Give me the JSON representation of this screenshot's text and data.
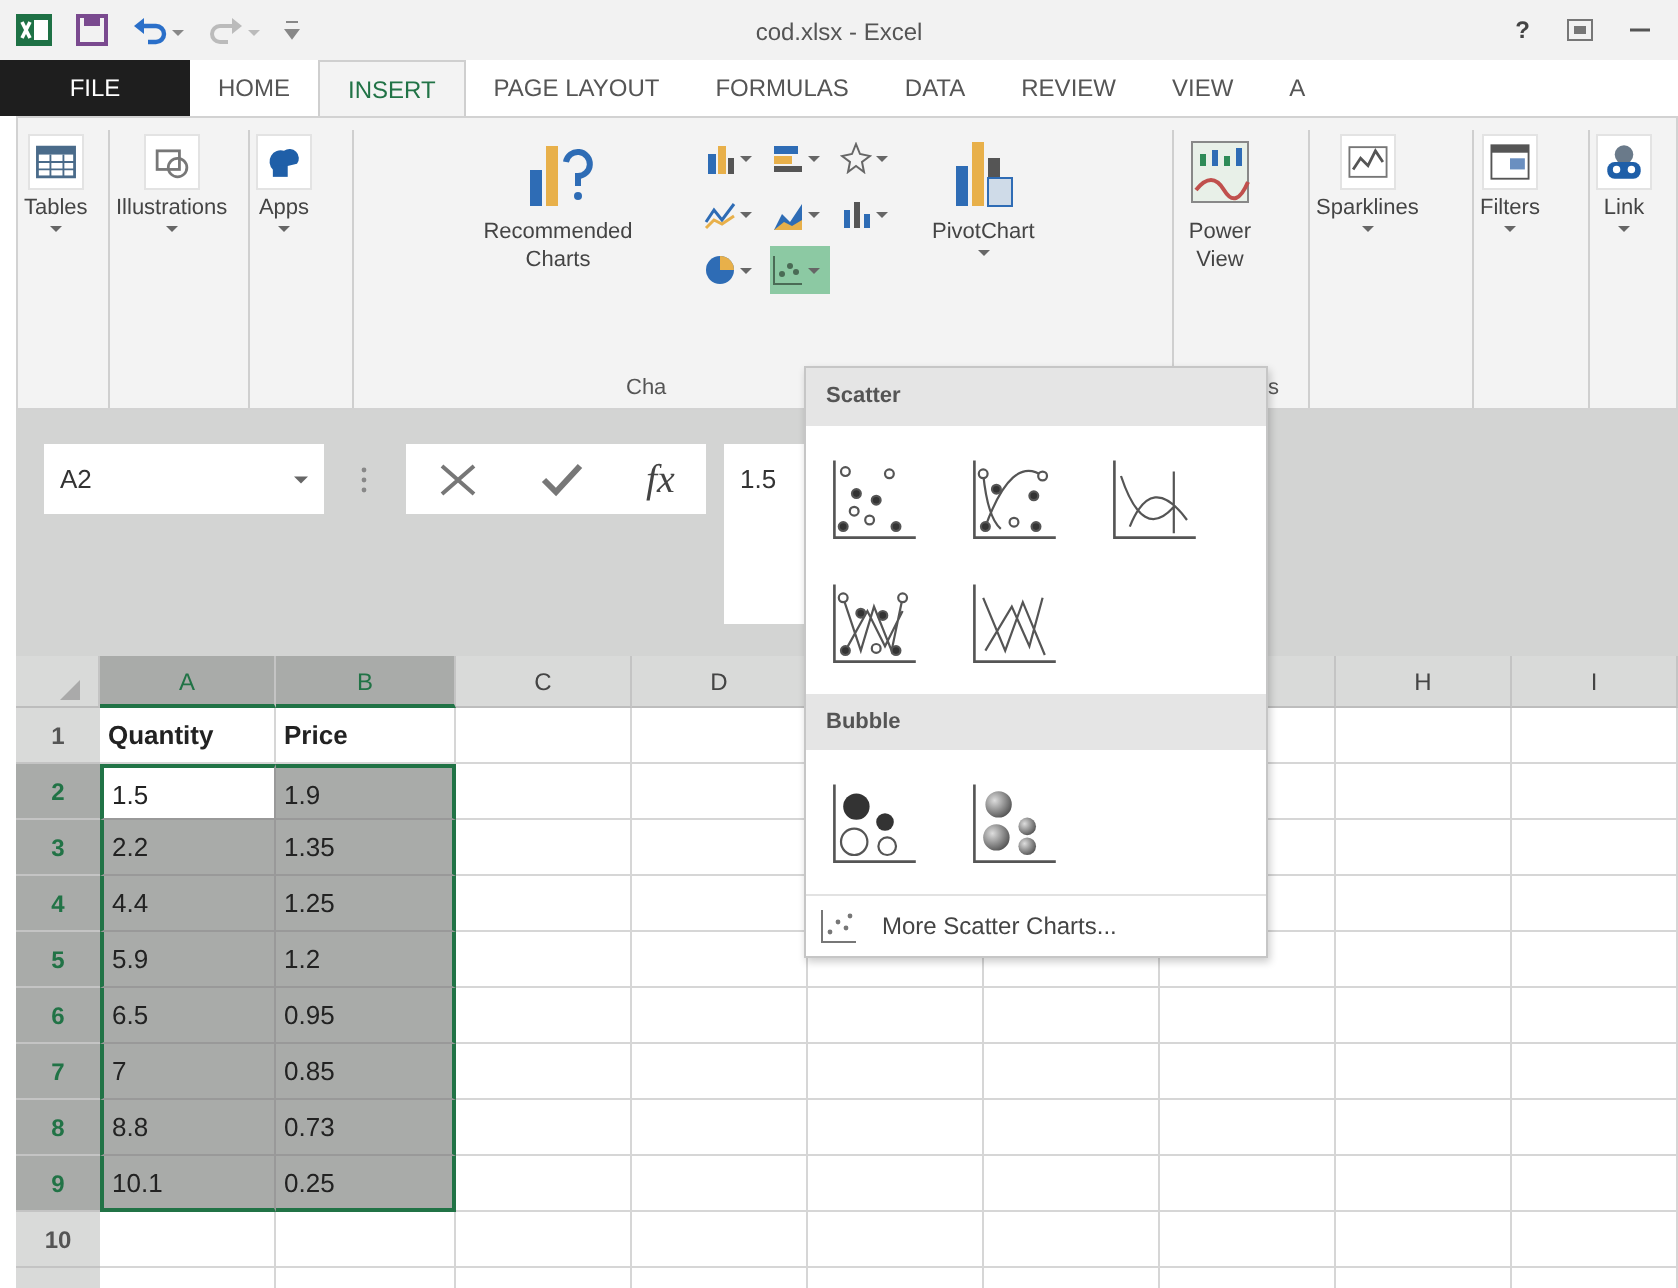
{
  "window": {
    "title": "cod.xlsx - Excel",
    "help": "?"
  },
  "tabs": [
    {
      "label": "FILE",
      "kind": "file",
      "selected": false
    },
    {
      "label": "HOME",
      "kind": "tab",
      "selected": false
    },
    {
      "label": "INSERT",
      "kind": "tab",
      "selected": true
    },
    {
      "label": "PAGE LAYOUT",
      "kind": "tab",
      "selected": false
    },
    {
      "label": "FORMULAS",
      "kind": "tab",
      "selected": false
    },
    {
      "label": "DATA",
      "kind": "tab",
      "selected": false
    },
    {
      "label": "REVIEW",
      "kind": "tab",
      "selected": false
    },
    {
      "label": "VIEW",
      "kind": "tab",
      "selected": false
    },
    {
      "label": "A",
      "kind": "tab",
      "selected": false
    }
  ],
  "ribbon": {
    "groups": [
      {
        "buttons": [
          {
            "kind": "tables",
            "label": "Tables",
            "dropdown": true
          }
        ]
      },
      {
        "buttons": [
          {
            "kind": "illustrations",
            "label": "Illustrations",
            "dropdown": true
          }
        ]
      },
      {
        "buttons": [
          {
            "kind": "apps",
            "label": "Apps",
            "dropdown": true
          }
        ]
      },
      {
        "label": "Cha",
        "buttons": [
          {
            "kind": "recommended-charts",
            "label": "Recommended Charts",
            "dropdown": false
          },
          {
            "kind": "chart-grid",
            "items": [
              {
                "kind": "column",
                "selected": false
              },
              {
                "kind": "bar",
                "selected": false
              },
              {
                "kind": "radar",
                "selected": false
              },
              {
                "kind": "line",
                "selected": false
              },
              {
                "kind": "area",
                "selected": false
              },
              {
                "kind": "stock",
                "selected": false
              },
              {
                "kind": "pie",
                "selected": false
              },
              {
                "kind": "scatter",
                "selected": true
              }
            ]
          },
          {
            "kind": "pivotchart",
            "label": "PivotChart",
            "dropdown": true
          }
        ]
      },
      {
        "label": "s",
        "buttons": [
          {
            "kind": "power-view",
            "label": "Power View",
            "dropdown": false
          }
        ]
      },
      {
        "buttons": [
          {
            "kind": "sparklines",
            "label": "Sparklines",
            "dropdown": true
          }
        ]
      },
      {
        "buttons": [
          {
            "kind": "filters",
            "label": "Filters",
            "dropdown": true
          }
        ]
      },
      {
        "buttons": [
          {
            "kind": "links",
            "label": "Link",
            "dropdown": true
          }
        ]
      }
    ]
  },
  "name_box": {
    "value": "A2"
  },
  "formula_bar": {
    "function_label": "fx",
    "value": "1.5"
  },
  "columns": [
    {
      "label": "A",
      "selected": true
    },
    {
      "label": "B",
      "selected": true
    },
    {
      "label": "C",
      "selected": false
    },
    {
      "label": "D",
      "selected": false
    },
    {},
    {},
    {},
    {
      "label": "H",
      "selected": false
    },
    {
      "label": "I",
      "selected": false
    }
  ],
  "rows": [
    {
      "number": "1",
      "selected": false,
      "cells": [
        {
          "text": "Quantity",
          "active": false
        },
        {
          "text": "Price",
          "active": false
        }
      ]
    },
    {
      "number": "2",
      "selected": true,
      "cells": [
        {
          "text": "1.5",
          "active": true
        },
        {
          "text": "1.9",
          "active": false
        }
      ]
    },
    {
      "number": "3",
      "selected": true,
      "cells": [
        {
          "text": "2.2",
          "active": false
        },
        {
          "text": "1.35",
          "active": false
        }
      ]
    },
    {
      "number": "4",
      "selected": true,
      "cells": [
        {
          "text": "4.4",
          "active": false
        },
        {
          "text": "1.25",
          "active": false
        }
      ]
    },
    {
      "number": "5",
      "selected": true,
      "cells": [
        {
          "text": "5.9",
          "active": false
        },
        {
          "text": "1.2",
          "active": false
        }
      ]
    },
    {
      "number": "6",
      "selected": true,
      "cells": [
        {
          "text": "6.5",
          "active": false
        },
        {
          "text": "0.95",
          "active": false
        }
      ]
    },
    {
      "number": "7",
      "selected": true,
      "cells": [
        {
          "text": "7",
          "active": false
        },
        {
          "text": "0.85",
          "active": false
        }
      ]
    },
    {
      "number": "8",
      "selected": true,
      "cells": [
        {
          "text": "8.8",
          "active": false
        },
        {
          "text": "0.73",
          "active": false
        }
      ]
    },
    {
      "number": "9",
      "selected": true,
      "cells": [
        {
          "text": "10.1",
          "active": false
        },
        {
          "text": "0.25",
          "active": false
        }
      ]
    },
    {
      "number": "10",
      "selected": false,
      "cells": []
    }
  ],
  "chart_menu": {
    "sections": [
      {
        "title": "Scatter",
        "items": [
          {
            "kind": "markers"
          },
          {
            "kind": "smooth-markers"
          },
          {
            "kind": "smooth"
          },
          {
            "kind": "straight-markers"
          },
          {
            "kind": "straight"
          }
        ]
      },
      {
        "title": "Bubble",
        "items": [
          {
            "kind": "bubble"
          },
          {
            "kind": "bubble-3d"
          }
        ]
      }
    ],
    "more": "More Scatter Charts..."
  }
}
